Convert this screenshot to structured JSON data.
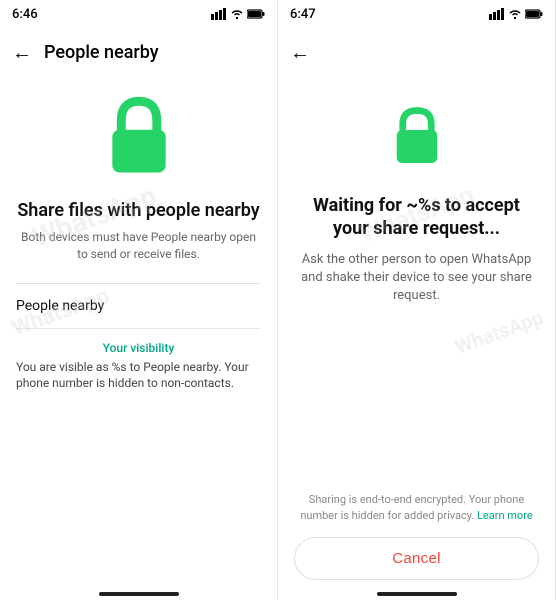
{
  "screen1": {
    "status": {
      "time": "6:46"
    },
    "header": {
      "back_label": "←",
      "title": "People nearby"
    },
    "lock_icon_label": "lock-icon",
    "share_title": "Share files with people nearby",
    "share_subtitle": "Both devices must have People nearby open to send or receive files.",
    "list_item": "People nearby",
    "section_label": "Your visibility",
    "visibility_text": "You are visible as %s to People nearby. Your phone number is hidden to non-contacts."
  },
  "screen2": {
    "status": {
      "time": "6:47"
    },
    "header": {
      "back_label": "←"
    },
    "lock_icon_label": "lock-icon",
    "waiting_title": "Waiting for ~%s to accept your share request...",
    "waiting_subtitle": "Ask the other person to open WhatsApp and shake their device to see your share request.",
    "privacy_text": "Sharing is end-to-end encrypted. Your phone number is hidden for added privacy.",
    "privacy_link_text": "Learn more",
    "cancel_label": "Cancel"
  }
}
